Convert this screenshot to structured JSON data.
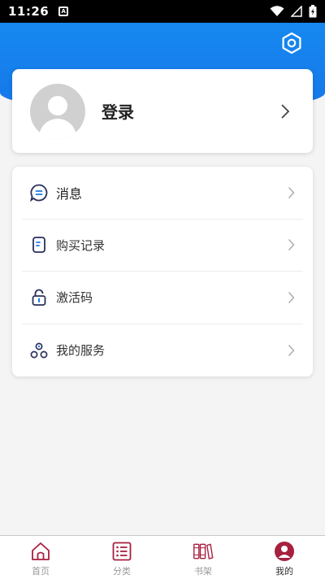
{
  "status_bar": {
    "time": "11:26",
    "notification_icon": "A"
  },
  "header": {
    "settings_icon": "settings-hexagon-icon"
  },
  "profile": {
    "login_label": "登录"
  },
  "menu": {
    "items": [
      {
        "label": "消息",
        "icon": "message-icon"
      },
      {
        "label": "购买记录",
        "icon": "purchase-record-icon"
      },
      {
        "label": "激活码",
        "icon": "lock-icon"
      },
      {
        "label": "我的服务",
        "icon": "services-icon"
      }
    ]
  },
  "tabs": [
    {
      "label": "首页",
      "icon": "home-icon",
      "active": false
    },
    {
      "label": "分类",
      "icon": "category-list-icon",
      "active": false
    },
    {
      "label": "书架",
      "icon": "bookshelf-icon",
      "active": false
    },
    {
      "label": "我的",
      "icon": "profile-icon",
      "active": true
    }
  ],
  "colors": {
    "header_blue": "#1680ec",
    "accent_red": "#a8203f",
    "text_dark": "#222222",
    "text_gray": "#999999"
  }
}
